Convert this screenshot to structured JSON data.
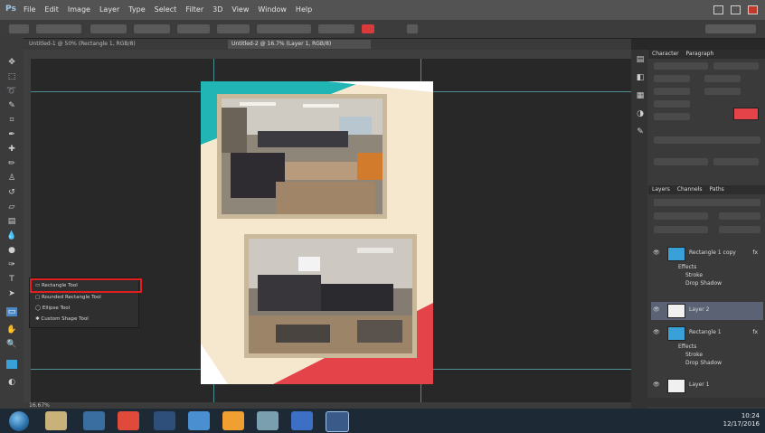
{
  "app": {
    "logo": "Ps"
  },
  "menu": {
    "items": [
      "File",
      "Edit",
      "Image",
      "Layer",
      "Type",
      "Select",
      "Filter",
      "3D",
      "View",
      "Window",
      "Help"
    ]
  },
  "tabs": [
    {
      "label": "Untitled-1 @ 50% (Rectangle 1, RGB/8)",
      "active": false
    },
    {
      "label": "Untitled-2 @ 16.7% (Layer 1, RGB/8)",
      "active": true
    }
  ],
  "context_menu": {
    "items": [
      "Rectangle Tool",
      "Rounded Rectangle Tool",
      "Ellipse Tool",
      "Custom Shape Tool"
    ],
    "highlighted_index": 0
  },
  "status": {
    "zoom": "16.67%"
  },
  "panels": {
    "top_tabs": [
      "Character",
      "Paragraph"
    ],
    "layers_tabs": [
      "Layers",
      "Channels",
      "Paths"
    ],
    "layers": [
      {
        "name": "Rectangle 1 copy",
        "fx": true,
        "effects": [
          "Effects",
          "Stroke",
          "Drop Shadow"
        ]
      },
      {
        "name": "Layer 2",
        "fx": false,
        "effects": []
      },
      {
        "name": "Rectangle 1",
        "fx": true,
        "effects": [
          "Effects",
          "Stroke",
          "Drop Shadow"
        ]
      },
      {
        "name": "Layer 1",
        "fx": false,
        "effects": []
      }
    ]
  },
  "colors": {
    "teal": "#21b5b5",
    "coral": "#e5434a",
    "paper": "#f6e8cf",
    "guide": "#4f8f94",
    "highlight": "#e02020"
  },
  "taskbar": {
    "time": "10:24",
    "date": "12/17/2016"
  }
}
